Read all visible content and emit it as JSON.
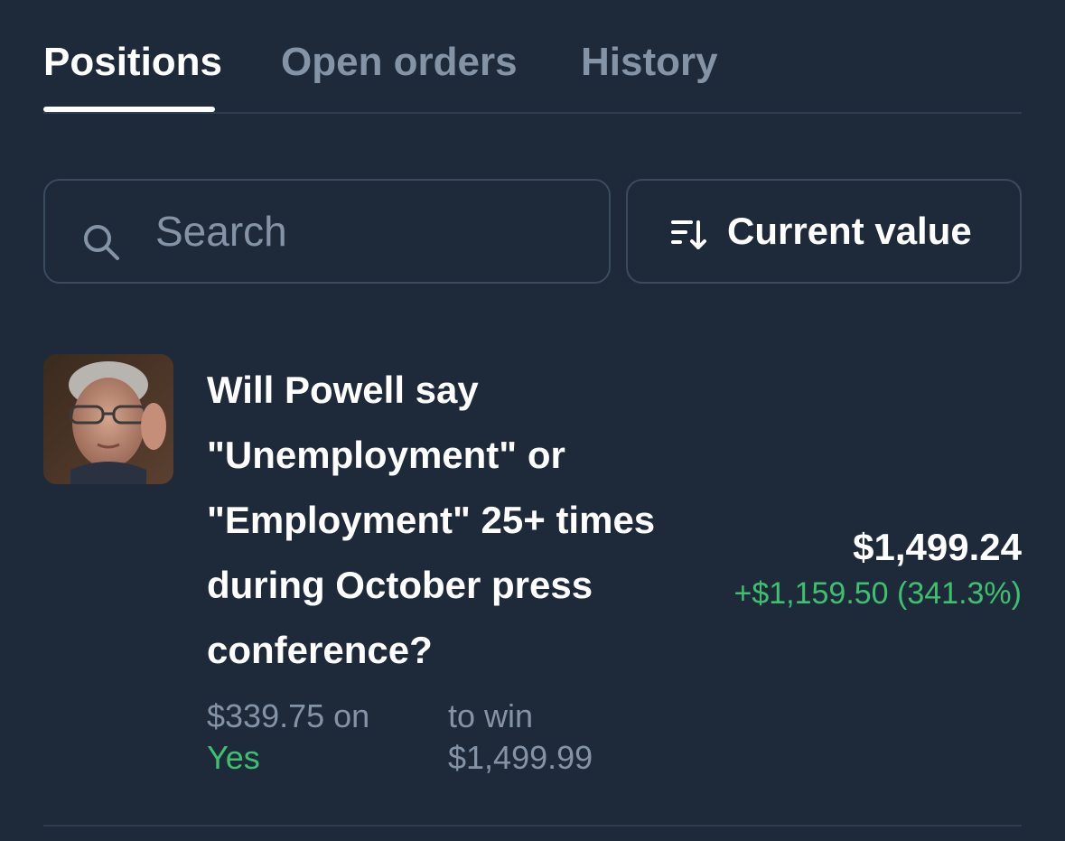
{
  "tabs": [
    {
      "label": "Positions",
      "active": true
    },
    {
      "label": "Open orders",
      "active": false
    },
    {
      "label": "History",
      "active": false
    }
  ],
  "search": {
    "placeholder": "Search",
    "value": "",
    "icon": "search-icon"
  },
  "sort": {
    "label": "Current value",
    "icon": "sort-descending-icon"
  },
  "positions": [
    {
      "title": "Will Powell say \"Unemployment\" or \"Employment\" 25+ times during October press conference?",
      "cost_text": "$339.75 on",
      "outcome": "Yes",
      "to_win_label": "to win",
      "to_win_value": "$1,499.99",
      "current_value": "$1,499.24",
      "pnl": "+$1,159.50 (341.3%)"
    }
  ],
  "colors": {
    "background": "#1e2a3a",
    "border": "#3b4b5e",
    "muted_text": "#8494a6",
    "positive": "#3dc070",
    "text": "#ffffff"
  }
}
